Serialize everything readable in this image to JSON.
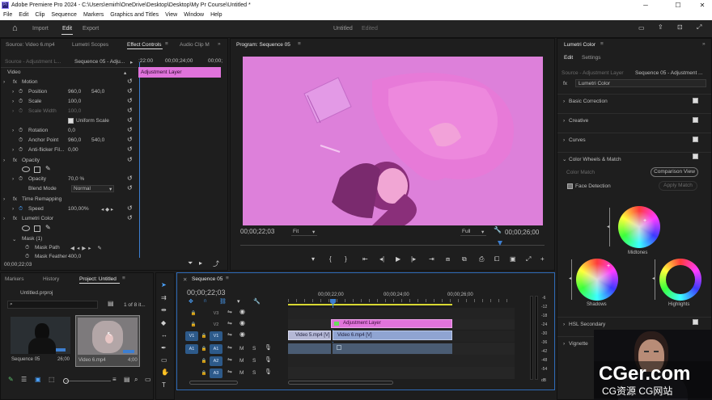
{
  "app": {
    "title": "Adobe Premiere Pro 2024 - C:\\Users\\emirh\\OneDrive\\Desktop\\Desktop\\My Pr Course\\Untitled *",
    "project": "Untitled",
    "status": "Edited"
  },
  "menu": [
    "File",
    "Edit",
    "Clip",
    "Sequence",
    "Markers",
    "Graphics and Titles",
    "View",
    "Window",
    "Help"
  ],
  "workspace_tabs": [
    "Import",
    "Edit",
    "Export"
  ],
  "source_panel": {
    "tabs": [
      "Source: Video 6.mp4",
      "Audio Track Mixer",
      "Lumetri Scopes",
      "Effect Controls",
      "Audio Clip M"
    ],
    "clip_selector": "Source - Adjustment L...",
    "sequence_selector": "Sequence 05 - Adju...",
    "ruler": [
      ":22:00",
      "00;00;24;00",
      "00;00;"
    ],
    "clip_bar": "Adjustment Layer",
    "video_header": "Video",
    "timecode": "00;00;22;03",
    "rows": [
      {
        "label": "Motion",
        "fx": true
      },
      {
        "label": "Position",
        "v1": "960,0",
        "v2": "540,0"
      },
      {
        "label": "Scale",
        "v1": "100,0"
      },
      {
        "label": "Scale Width",
        "v1": "100,0"
      },
      {
        "label": "Uniform Scale"
      },
      {
        "label": "Rotation",
        "v1": "0,0"
      },
      {
        "label": "Anchor Point",
        "v1": "960,0",
        "v2": "540,0"
      },
      {
        "label": "Anti-flicker Fil...",
        "v1": "0,00"
      },
      {
        "label": "Opacity",
        "fx": true
      },
      {
        "label": "Opacity",
        "v1": "70,0 %"
      },
      {
        "label": "Blend Mode",
        "v1": "Normal"
      },
      {
        "label": "Time Remapping",
        "fx": true
      },
      {
        "label": "Speed",
        "v1": "100,00%"
      },
      {
        "label": "Lumetri Color",
        "fx": true
      },
      {
        "label": "Mask (1)"
      },
      {
        "label": "Mask Path"
      },
      {
        "label": "Mask Feather",
        "v1": "400,0"
      }
    ]
  },
  "program": {
    "title": "Program: Sequence 05",
    "timecode": "00;00;22;03",
    "fit": "Fit",
    "quality": "Full",
    "duration": "00;00;26;00"
  },
  "lumetri": {
    "title": "Lumetri Color",
    "tabs": [
      "Edit",
      "Settings"
    ],
    "source": "Source - Adjustment Layer",
    "sequence": "Sequence 05 - Adjustment ...",
    "preset": "Lumetri Color",
    "sections": [
      "Basic Correction",
      "Creative",
      "Curves",
      "Color Wheels & Match",
      "HSL Secondary",
      "Vignette"
    ],
    "color_match": "Color Match",
    "comparison_view": "Comparison View",
    "face_detection": "Face Detection",
    "apply_match": "Apply Match",
    "wheels": [
      "Midtones",
      "Shadows",
      "Highlights"
    ]
  },
  "project": {
    "tabs": [
      "Markers",
      "History",
      "Project: Untitled"
    ],
    "file": "Untitled.prproj",
    "count": "1 of 8 it...",
    "items": [
      {
        "name": "Sequence 05",
        "duration": "26;00"
      },
      {
        "name": "Video 6.mp4",
        "duration": "4;00"
      }
    ]
  },
  "timeline": {
    "tab": "Sequence 05",
    "timecode": "00;00;22;03",
    "ruler": [
      "00;00;22;00",
      "00;00;24;00",
      "00;00;26;00"
    ],
    "tracks": [
      "V3",
      "V2",
      "V1",
      "A1",
      "A2",
      "A3"
    ],
    "clips": {
      "adj": "Adjustment Layer",
      "v5": "Video 5.mp4 [V]",
      "v6": "Video 6.mp4 [V]"
    },
    "meter": [
      "-6",
      "-12",
      "-18",
      "-24",
      "-30",
      "-36",
      "-42",
      "-48",
      "-54",
      "dB"
    ]
  },
  "watermark": {
    "brand": "CGer.com",
    "sub": "CG资源 CG网站"
  }
}
